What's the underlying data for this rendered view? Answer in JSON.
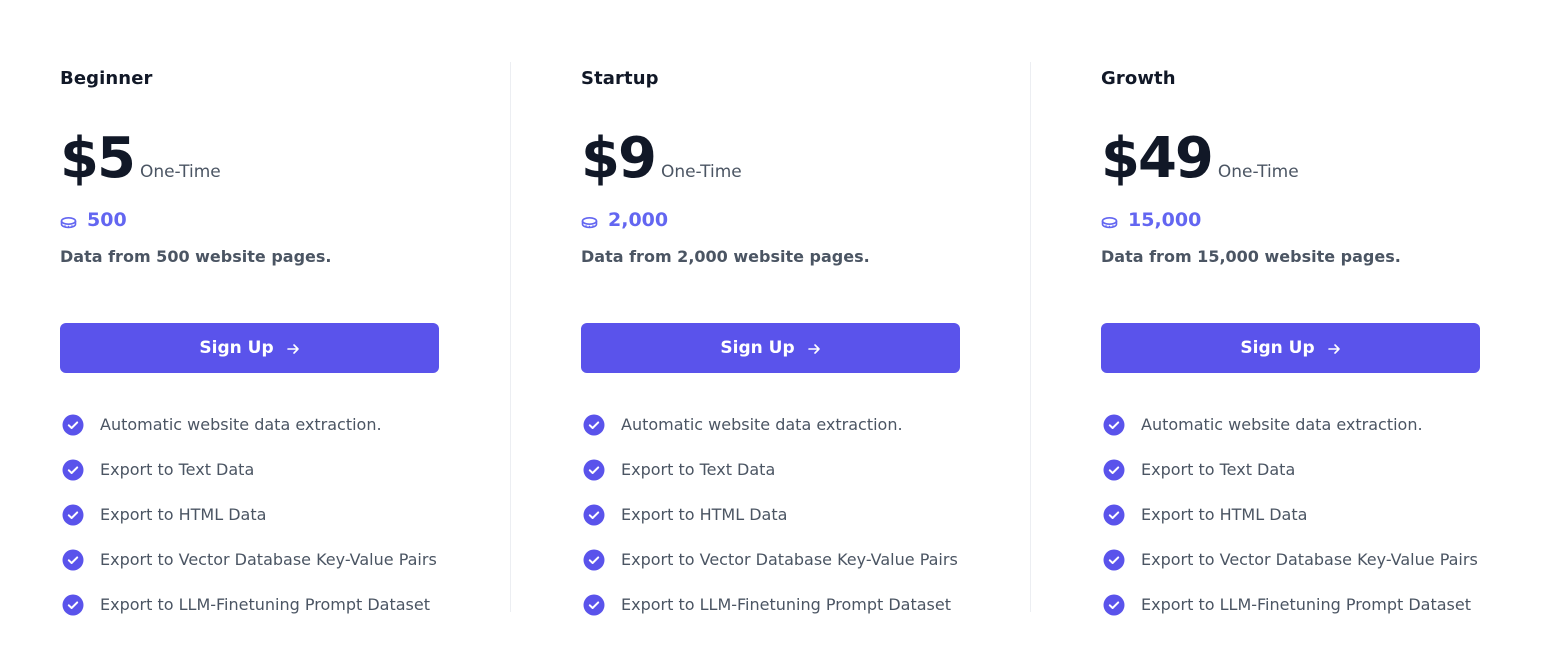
{
  "colors": {
    "accent": "#5a53eb",
    "credits_text": "#6366f1",
    "heading": "#111827",
    "body_text": "#4b5563",
    "divider": "#eceef2"
  },
  "plans": [
    {
      "name": "Beginner",
      "price": "$5",
      "period": "One-Time",
      "credits_icon": "coin-icon",
      "credits": "500",
      "description": "Data from 500 website pages.",
      "cta_label": "Sign Up",
      "cta_icon": "arrow-right-icon",
      "features": [
        "Automatic website data extraction.",
        "Export to Text Data",
        "Export to HTML Data",
        "Export to Vector Database Key-Value Pairs",
        "Export to LLM-Finetuning Prompt Dataset"
      ]
    },
    {
      "name": "Startup",
      "price": "$9",
      "period": "One-Time",
      "credits_icon": "coin-icon",
      "credits": "2,000",
      "description": "Data from 2,000 website pages.",
      "cta_label": "Sign Up",
      "cta_icon": "arrow-right-icon",
      "features": [
        "Automatic website data extraction.",
        "Export to Text Data",
        "Export to HTML Data",
        "Export to Vector Database Key-Value Pairs",
        "Export to LLM-Finetuning Prompt Dataset"
      ]
    },
    {
      "name": "Growth",
      "price": "$49",
      "period": "One-Time",
      "credits_icon": "coin-icon",
      "credits": "15,000",
      "description": "Data from 15,000 website pages.",
      "cta_label": "Sign Up",
      "cta_icon": "arrow-right-icon",
      "features": [
        "Automatic website data extraction.",
        "Export to Text Data",
        "Export to HTML Data",
        "Export to Vector Database Key-Value Pairs",
        "Export to LLM-Finetuning Prompt Dataset"
      ]
    }
  ]
}
